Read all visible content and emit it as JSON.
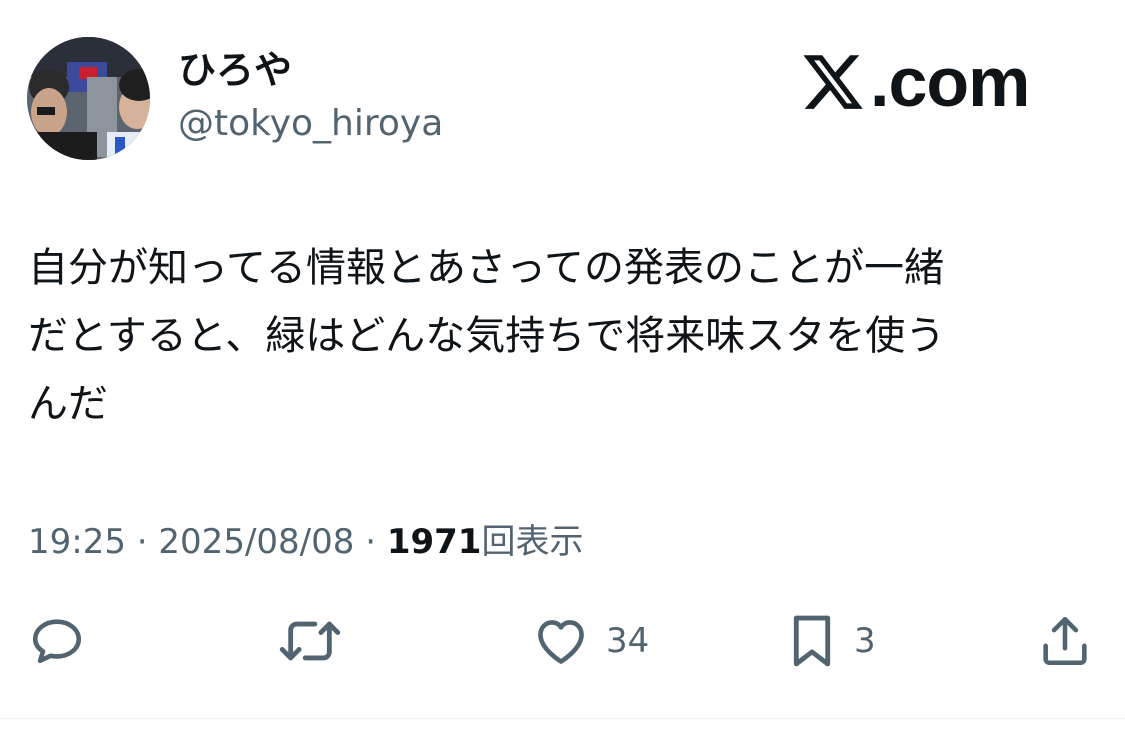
{
  "user": {
    "display_name": "ひろや",
    "handle": "@tokyo_hiroya"
  },
  "brand": {
    "text": ".com",
    "icon": "x-logo-icon"
  },
  "tweet": {
    "text": "自分が知ってる情報とあさっての発表のことが一緒\nだとすると、緑はどんな気持ちで将来味スタを使う\nんだ"
  },
  "meta": {
    "time": "19:25",
    "separator": "·",
    "date": "2025/08/08",
    "views_count": "1971",
    "views_label": "回表示"
  },
  "actions": {
    "reply": {
      "icon": "reply-icon"
    },
    "retweet": {
      "icon": "retweet-icon"
    },
    "like": {
      "icon": "heart-icon",
      "count": "34"
    },
    "bookmark": {
      "icon": "bookmark-icon",
      "count": "3"
    },
    "share": {
      "icon": "share-icon"
    }
  },
  "colors": {
    "text": "#0f1419",
    "secondary": "#536471",
    "background": "#ffffff"
  }
}
